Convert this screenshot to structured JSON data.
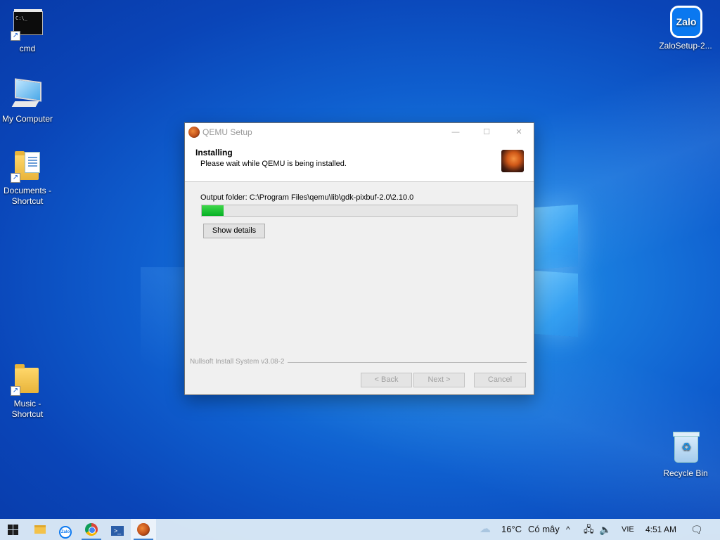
{
  "desktop": {
    "icons": [
      {
        "label": "cmd",
        "cmd_text": "C:\\_"
      },
      {
        "label": "My Computer"
      },
      {
        "label": "Documents - Shortcut"
      },
      {
        "label": "Music - Shortcut"
      },
      {
        "label": "ZaloSetup-2...",
        "logo_text": "Zalo"
      },
      {
        "label": "Recycle Bin"
      }
    ]
  },
  "installer": {
    "title": "QEMU Setup",
    "window_controls": {
      "minimize": "—",
      "maximize": "☐",
      "close": "✕"
    },
    "header_title": "Installing",
    "header_subtitle": "Please wait while QEMU is being installed.",
    "output_folder": "Output folder: C:\\Program Files\\qemu\\lib\\gdk-pixbuf-2.0\\2.10.0",
    "progress_percent": 7,
    "show_details_label": "Show details",
    "branding": "Nullsoft Install System v3.08-2",
    "back_label": "< Back",
    "next_label": "Next >",
    "cancel_label": "Cancel"
  },
  "taskbar": {
    "apps": [
      {
        "name": "start-icon"
      },
      {
        "name": "file-explorer-icon"
      },
      {
        "name": "zalo-icon",
        "text": "Zalo"
      },
      {
        "name": "chrome-icon"
      },
      {
        "name": "powershell-icon",
        "text": ">_"
      },
      {
        "name": "qemu-icon"
      }
    ],
    "tray": {
      "temperature": "16°C",
      "weather": "Có mây",
      "chevron": "^",
      "network": "🖧",
      "volume": "🔈",
      "language": "VIE",
      "time": "4:51 AM",
      "notifications": "🗨"
    }
  },
  "colors": {
    "desktop_blue": "#0f5fcf",
    "progress_green": "#06b025",
    "taskbar": "#dceaf6"
  }
}
